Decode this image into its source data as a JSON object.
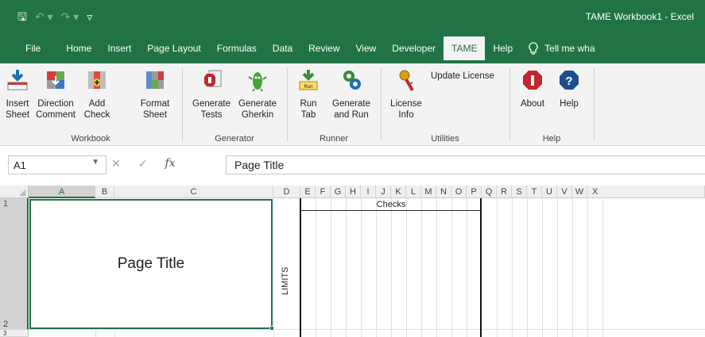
{
  "window": {
    "title": "TAME Workbook1  -  Excel",
    "qat": {
      "save": "🖫",
      "undo": "↶ ▾",
      "redo": "↷ ▾",
      "customize": "▿"
    }
  },
  "tabs": [
    {
      "label": "File"
    },
    {
      "label": "Home"
    },
    {
      "label": "Insert"
    },
    {
      "label": "Page Layout"
    },
    {
      "label": "Formulas"
    },
    {
      "label": "Data"
    },
    {
      "label": "Review"
    },
    {
      "label": "View"
    },
    {
      "label": "Developer"
    },
    {
      "label": "TAME",
      "active": true
    },
    {
      "label": "Help"
    }
  ],
  "tell_me": {
    "icon": "lightbulb-icon",
    "label": "Tell me wha"
  },
  "ribbon": {
    "groups": [
      {
        "label": "Workbook",
        "buttons": [
          {
            "label1": "Insert",
            "label2": "Sheet",
            "icon": "insert-sheet-icon"
          },
          {
            "label1": "Direction",
            "label2": "Comment",
            "icon": "direction-comment-icon"
          },
          {
            "label1": "Add",
            "label2": "Check",
            "icon": "add-check-icon"
          },
          {
            "label1": "Format",
            "label2": "Sheet",
            "icon": "format-sheet-icon"
          }
        ]
      },
      {
        "label": "Generator",
        "buttons": [
          {
            "label1": "Generate",
            "label2": "Tests",
            "icon": "generate-tests-icon"
          },
          {
            "label1": "Generate",
            "label2": "Gherkin",
            "icon": "generate-gherkin-icon"
          }
        ]
      },
      {
        "label": "Runner",
        "buttons": [
          {
            "label1": "Run",
            "label2": "Tab",
            "icon": "run-tab-icon"
          },
          {
            "label1": "Generate",
            "label2": "and Run",
            "icon": "generate-and-run-icon"
          }
        ]
      },
      {
        "label": "Utilities",
        "buttons": [
          {
            "label1": "License",
            "label2": "Info",
            "icon": "license-info-icon"
          },
          {
            "label1": "Update License",
            "label2": "",
            "icon": "update-license-icon"
          }
        ]
      },
      {
        "label": "Help",
        "buttons": [
          {
            "label1": "About",
            "label2": "",
            "icon": "about-icon"
          },
          {
            "label1": "Help",
            "label2": "",
            "icon": "help-icon"
          }
        ]
      }
    ]
  },
  "formula_bar": {
    "name_box": "A1",
    "cancel": "✕",
    "enter": "✓",
    "fx": "fx",
    "content": "Page Title"
  },
  "grid": {
    "columns": [
      "A",
      "B",
      "C",
      "D",
      "E",
      "F",
      "G",
      "H",
      "I",
      "J",
      "K",
      "L",
      "M",
      "N",
      "O",
      "P",
      "Q",
      "R",
      "S",
      "T",
      "U",
      "V",
      "W",
      "X"
    ],
    "rows": [
      "1",
      "2",
      "3"
    ],
    "cells": {
      "A1": "Page Title",
      "D2": "LIMITS",
      "E1": "Checks"
    }
  },
  "colors": {
    "accent": "#217346",
    "ribbon_bg": "#f3f3f3"
  }
}
